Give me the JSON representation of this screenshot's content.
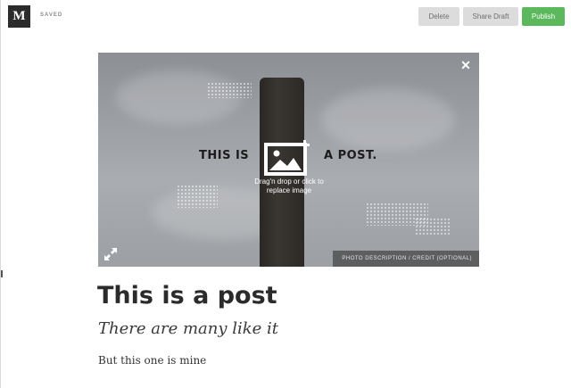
{
  "app": {
    "logo_letter": "M",
    "status": "SAVED"
  },
  "toolbar": {
    "delete_label": "Delete",
    "share_label": "Share Draft",
    "publish_label": "Publish"
  },
  "hero": {
    "text_left": "THIS IS",
    "text_right": "A POST.",
    "hint_line1": "Drag'n drop or click to",
    "hint_line2": "replace image",
    "caption": "PHOTO DESCRIPTION / CREDIT (OPTIONAL)",
    "close_glyph": "✕"
  },
  "post": {
    "title": "This is a post",
    "subtitle": "There are many like it",
    "body": "But this one is mine"
  },
  "colors": {
    "publish": "#5cb85c",
    "secondary_button": "#dcdcdc",
    "logo_bg": "#2b2b2b"
  },
  "icons": [
    "medium-logo",
    "close-icon",
    "add-image-icon",
    "expand-icon"
  ]
}
